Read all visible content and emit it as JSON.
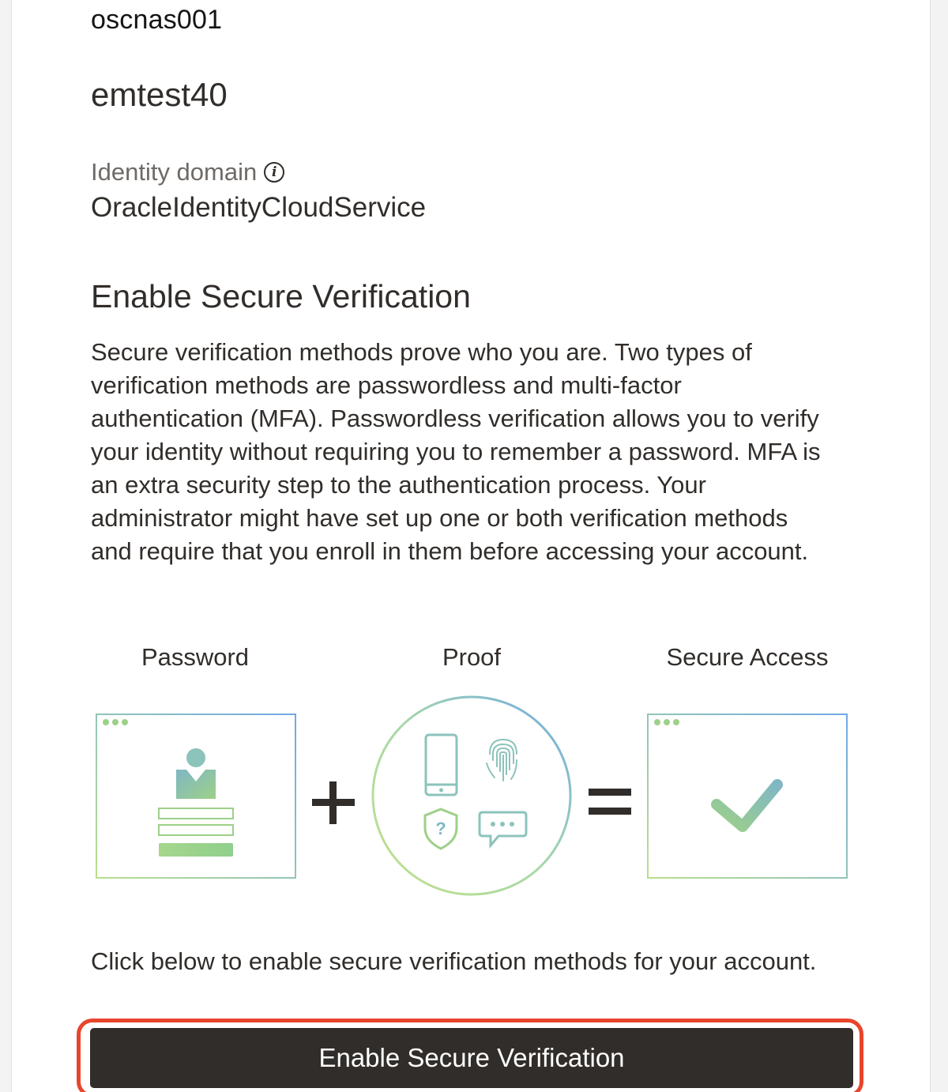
{
  "header": {
    "tenant_name": "oscnas001",
    "username": "emtest40"
  },
  "identity_domain": {
    "label": "Identity domain",
    "info_icon": "info-icon",
    "value": "OracleIdentityCloudService"
  },
  "section": {
    "title": "Enable Secure Verification",
    "description": "Secure verification methods prove who you are. Two types of verification methods are passwordless and multi-factor authentication (MFA). Passwordless verification allows you to verify your identity without requiring you to remember a password. MFA is an extra security step to the authentication process. Your administrator might have set up one or both verification methods and require that you enroll in them before accessing your account."
  },
  "illustration": {
    "labels": [
      "Password",
      "Proof",
      "Secure Access"
    ],
    "colors": {
      "gradient_start": "#b8df8c",
      "gradient_end": "#6fa9e6",
      "icon_teal": "#7fbcb0",
      "icon_green": "#9dd088",
      "operator": "#312d2a"
    },
    "icons": [
      "user-icon",
      "phone-icon",
      "fingerprint-icon",
      "shield-question-icon",
      "chat-bubble-icon",
      "checkmark-icon"
    ]
  },
  "cta": {
    "text": "Click below to enable secure verification methods for your account.",
    "button_label": "Enable Secure Verification",
    "highlight_color": "#e8452d",
    "button_color": "#312d2a"
  }
}
